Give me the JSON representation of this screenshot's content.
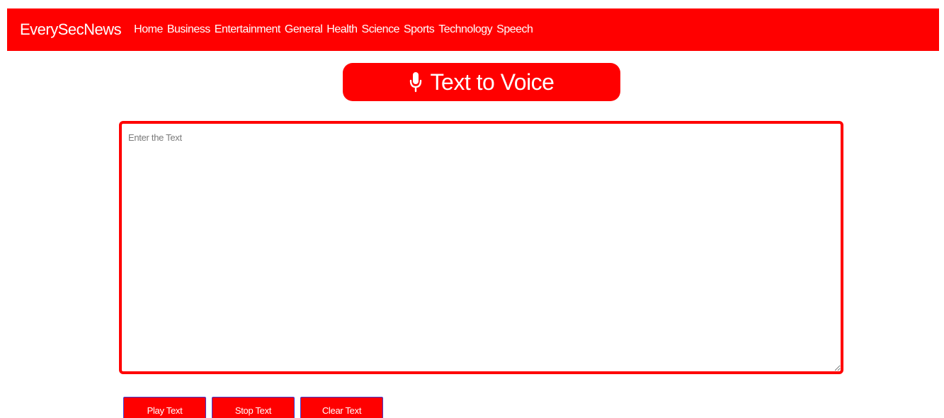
{
  "navbar": {
    "brand": "EverySecNews",
    "links": [
      {
        "label": "Home"
      },
      {
        "label": "Business"
      },
      {
        "label": "Entertainment"
      },
      {
        "label": "General"
      },
      {
        "label": "Health"
      },
      {
        "label": "Science"
      },
      {
        "label": "Sports"
      },
      {
        "label": "Technology"
      },
      {
        "label": "Speech"
      }
    ],
    "background": "#ff0000"
  },
  "header": {
    "title": "Text to Voice",
    "icon": "microphone-icon"
  },
  "input": {
    "value": "",
    "placeholder": "Enter the Text"
  },
  "actions": {
    "play_label": "Play Text",
    "stop_label": "Stop Text",
    "clear_label": "Clear Text"
  },
  "colors": {
    "accent": "#ff0000",
    "button_border": "#3b3bd6",
    "text_on_accent": "#ffffff"
  }
}
